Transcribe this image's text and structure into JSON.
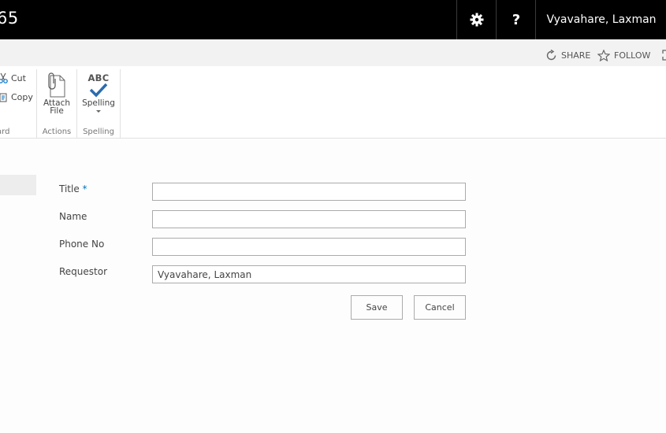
{
  "suitebar": {
    "title": "65",
    "user_name": "Vyavahare, Laxman",
    "help_glyph": "?"
  },
  "actionbar": {
    "share_label": "SHARE",
    "follow_label": "FOLLOW"
  },
  "ribbon": {
    "clipboard": {
      "label": "ard",
      "cut_label": "Cut",
      "copy_label": "Copy"
    },
    "actions": {
      "label": "Actions",
      "attach_line1": "Attach",
      "attach_line2": "File"
    },
    "spelling": {
      "label": "Spelling",
      "abc_text": "ABC",
      "spelling_label": "Spelling"
    }
  },
  "form": {
    "title_label": "Title",
    "required_marker": "*",
    "title_value": "",
    "name_label": "Name",
    "name_value": "",
    "phone_label": "Phone No",
    "phone_value": "",
    "requestor_label": "Requestor",
    "requestor_value": "Vyavahare, Laxman",
    "save_label": "Save",
    "cancel_label": "Cancel"
  },
  "colors": {
    "suitebar_bg": "#000000",
    "accent": "#0072c6",
    "spelling_check": "#2b6cb0"
  }
}
